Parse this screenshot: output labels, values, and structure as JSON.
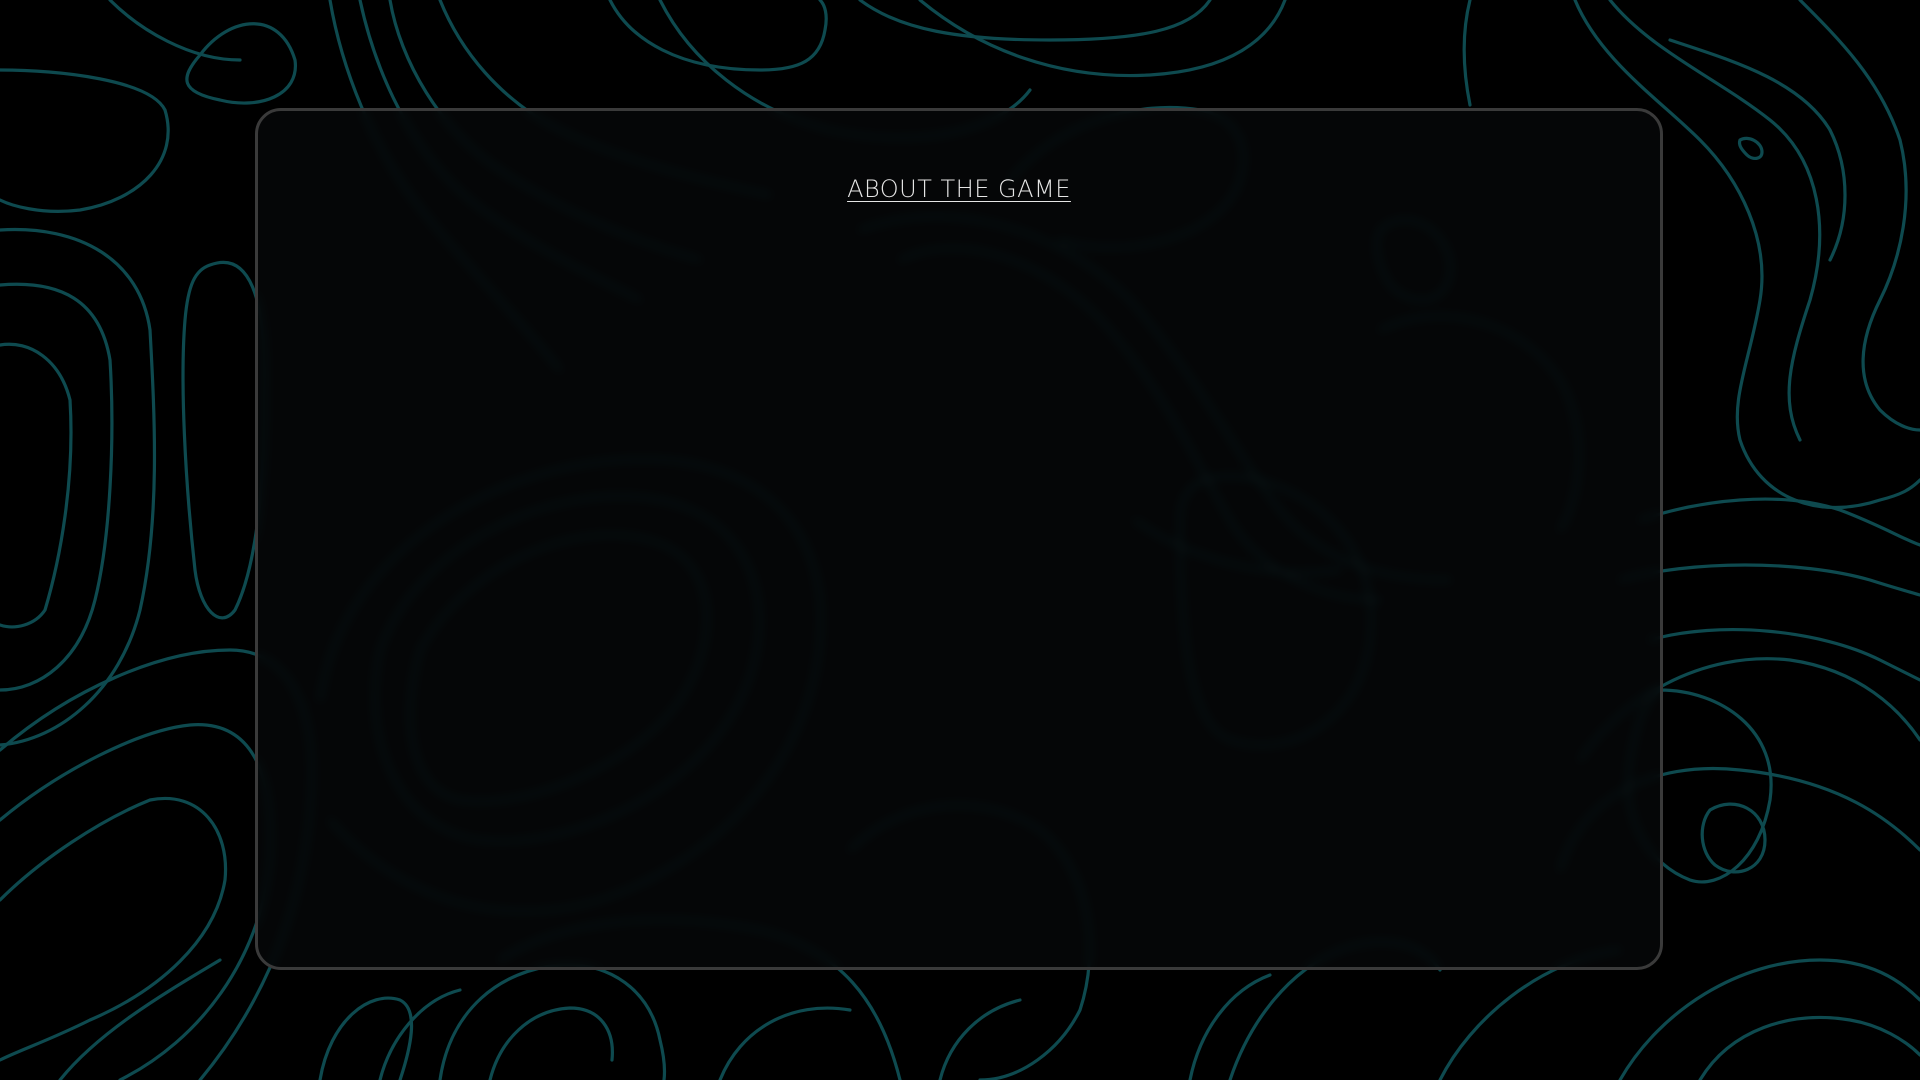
{
  "page": {
    "background_color": "#000000",
    "pattern": "topographic-contour-lines",
    "pattern_color": "#0e4a4f"
  },
  "panel": {
    "title": "ABOUT THE GAME",
    "border_color": "#3a3a3a",
    "title_color": "#e6e6e6"
  }
}
